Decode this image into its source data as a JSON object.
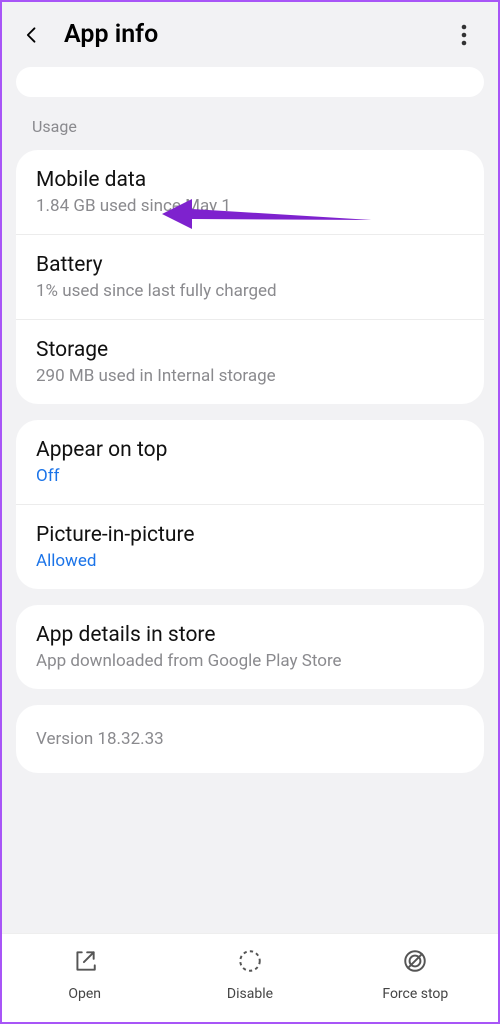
{
  "header": {
    "title": "App info"
  },
  "section_usage_label": "Usage",
  "usage": {
    "mobile_data": {
      "title": "Mobile data",
      "sub": "1.84 GB used since May 1"
    },
    "battery": {
      "title": "Battery",
      "sub": "1% used since last fully charged"
    },
    "storage": {
      "title": "Storage",
      "sub": "290 MB used in Internal storage"
    }
  },
  "overlay": {
    "appear_on_top": {
      "title": "Appear on top",
      "value": "Off"
    },
    "pip": {
      "title": "Picture-in-picture",
      "value": "Allowed"
    }
  },
  "store": {
    "title": "App details in store",
    "sub": "App downloaded from Google Play Store"
  },
  "version_text": "Version 18.32.33",
  "bottom": {
    "open": "Open",
    "disable": "Disable",
    "force_stop": "Force stop"
  }
}
